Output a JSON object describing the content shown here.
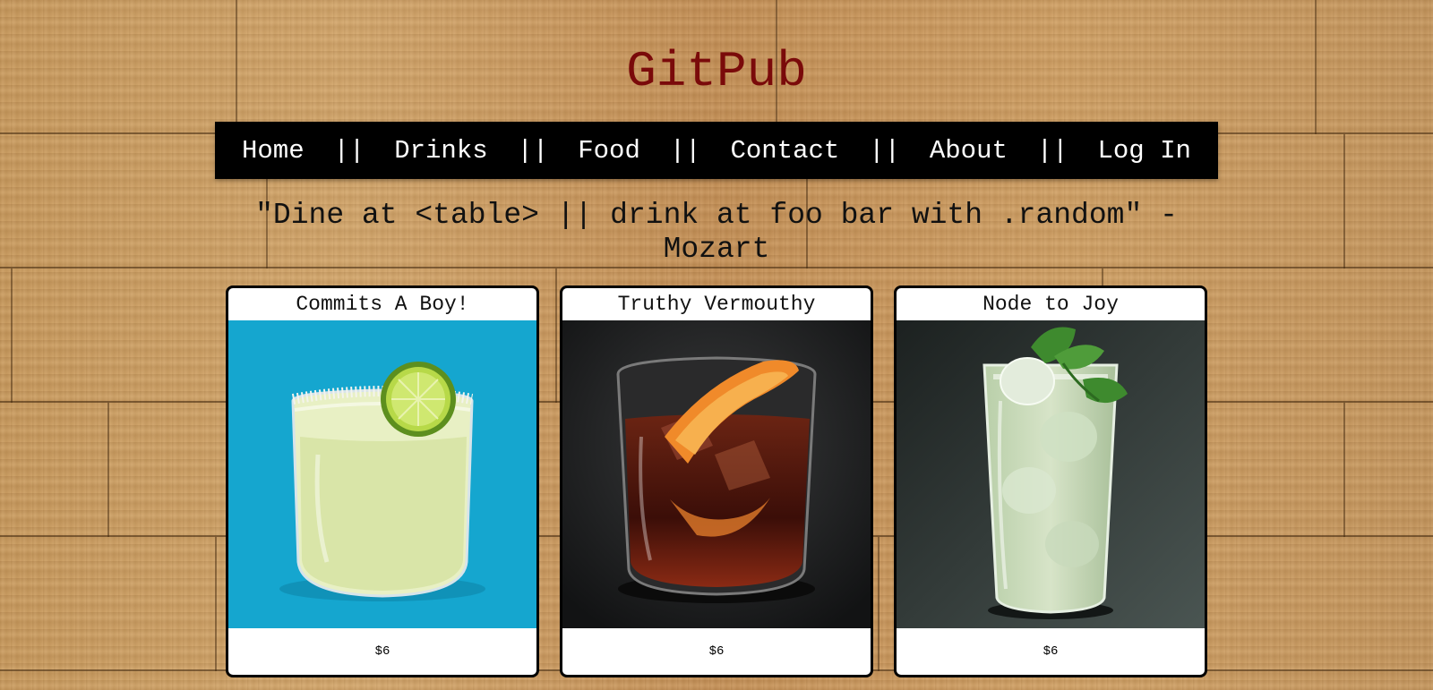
{
  "site": {
    "title": "GitPub",
    "quote": "\"Dine at <table> || drink at foo bar with .random\" - Mozart"
  },
  "nav": {
    "items": [
      "Home",
      "Drinks",
      "Food",
      "Contact",
      "About",
      "Log In"
    ],
    "separator": "||"
  },
  "drinks": [
    {
      "name": "Commits A Boy!",
      "price": "$6",
      "photo": "margarita-glass-with-salt-rim-and-lime",
      "background": "#15a6cf"
    },
    {
      "name": "Truthy Vermouthy",
      "price": "$6",
      "photo": "negroni-glass-with-orange-peel",
      "background": "#1e1f20"
    },
    {
      "name": "Node to Joy",
      "price": "$6",
      "photo": "mojito-highball-with-mint",
      "background": "#2c3432"
    }
  ],
  "colors": {
    "title": "#7a0a0a",
    "nav_background": "#000000",
    "nav_text": "#ffffff",
    "card_background": "#ffffff",
    "wood": "#c69a60"
  }
}
